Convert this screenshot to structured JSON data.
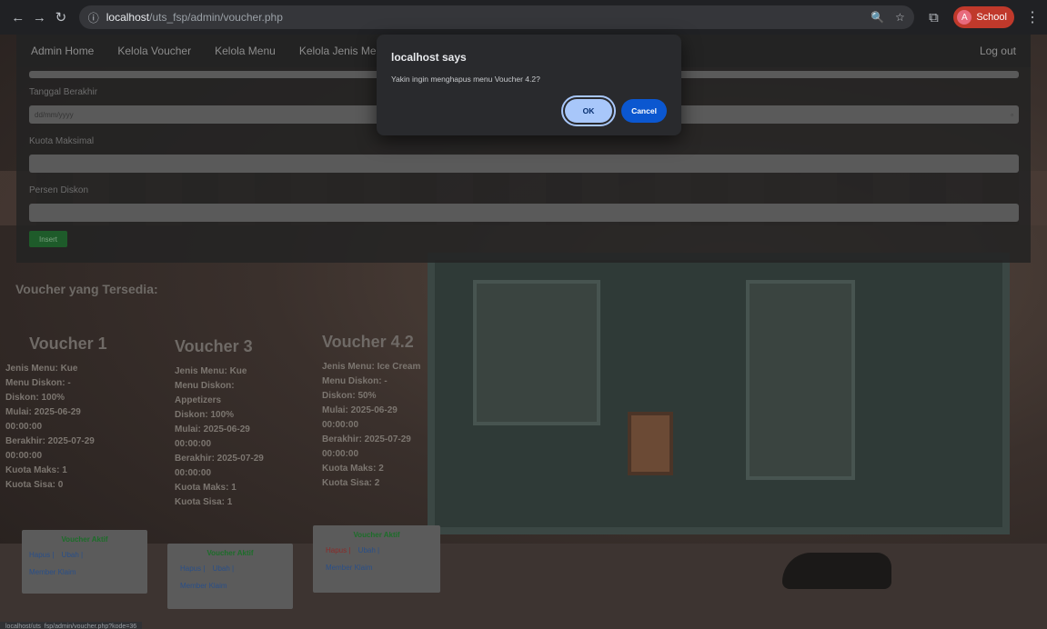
{
  "browser": {
    "url_host": "localhost",
    "url_path": "/uts_fsp/admin/voucher.php",
    "profile_initial": "A",
    "profile_name": "School"
  },
  "navbar": {
    "items": [
      "Admin Home",
      "Kelola Voucher",
      "Kelola Menu",
      "Kelola Jenis Menu"
    ],
    "logout": "Log out"
  },
  "form": {
    "tanggal_berakhir_label": "Tanggal Berakhir",
    "tanggal_berakhir_value": "dd/mm/yyyy",
    "kuota_label": "Kuota Maksimal",
    "pesan_label": "Persen Diskon",
    "submit": "Insert"
  },
  "section_title": "Voucher yang Tersedia:",
  "vouchers": [
    {
      "title": "Voucher 1",
      "jenis": "Jenis Menu: Kue",
      "menu": "Menu Diskon: -",
      "diskon": "Diskon: 100%",
      "mulai": "Mulai: 2025-06-29",
      "mulai_time": "00:00:00",
      "berakhir": "Berakhir: 2025-07-29",
      "berakhir_time": "00:00:00",
      "kuota_maks": "Kuota Maks: 1",
      "kuota_sisa": "Kuota Sisa: 0",
      "aktif": "Voucher Aktif",
      "hapus": "Hapus |",
      "ubah": "Ubah |",
      "member": "Member Klaim"
    },
    {
      "title": "Voucher 3",
      "jenis": "Jenis Menu: Kue",
      "menu": "Menu Diskon:",
      "menu2": "Appetizers",
      "diskon": "Diskon: 100%",
      "mulai": "Mulai: 2025-06-29",
      "mulai_time": "00:00:00",
      "berakhir": "Berakhir: 2025-07-29",
      "berakhir_time": "00:00:00",
      "kuota_maks": "Kuota Maks: 1",
      "kuota_sisa": "Kuota Sisa: 1",
      "aktif": "Voucher Aktif",
      "hapus": "Hapus |",
      "ubah": "Ubah |",
      "member": "Member Klaim"
    },
    {
      "title": "Voucher 4.2",
      "jenis": "Jenis Menu: Ice Cream",
      "menu": "Menu Diskon: -",
      "diskon": "Diskon: 50%",
      "mulai": "Mulai: 2025-06-29",
      "mulai_time": "00:00:00",
      "berakhir": "Berakhir: 2025-07-29",
      "berakhir_time": "00:00:00",
      "kuota_maks": "Kuota Maks: 2",
      "kuota_sisa": "Kuota Sisa: 2",
      "aktif": "Voucher Aktif",
      "hapus": "Hapus |",
      "ubah": "Ubah |",
      "member": "Member Klaim"
    }
  ],
  "statusbar": "localhost/uts_fsp/admin/voucher.php?kode=36",
  "dialog": {
    "title": "localhost says",
    "message": "Yakin ingin menghapus menu Voucher 4.2?",
    "ok": "OK",
    "cancel": "Cancel"
  }
}
